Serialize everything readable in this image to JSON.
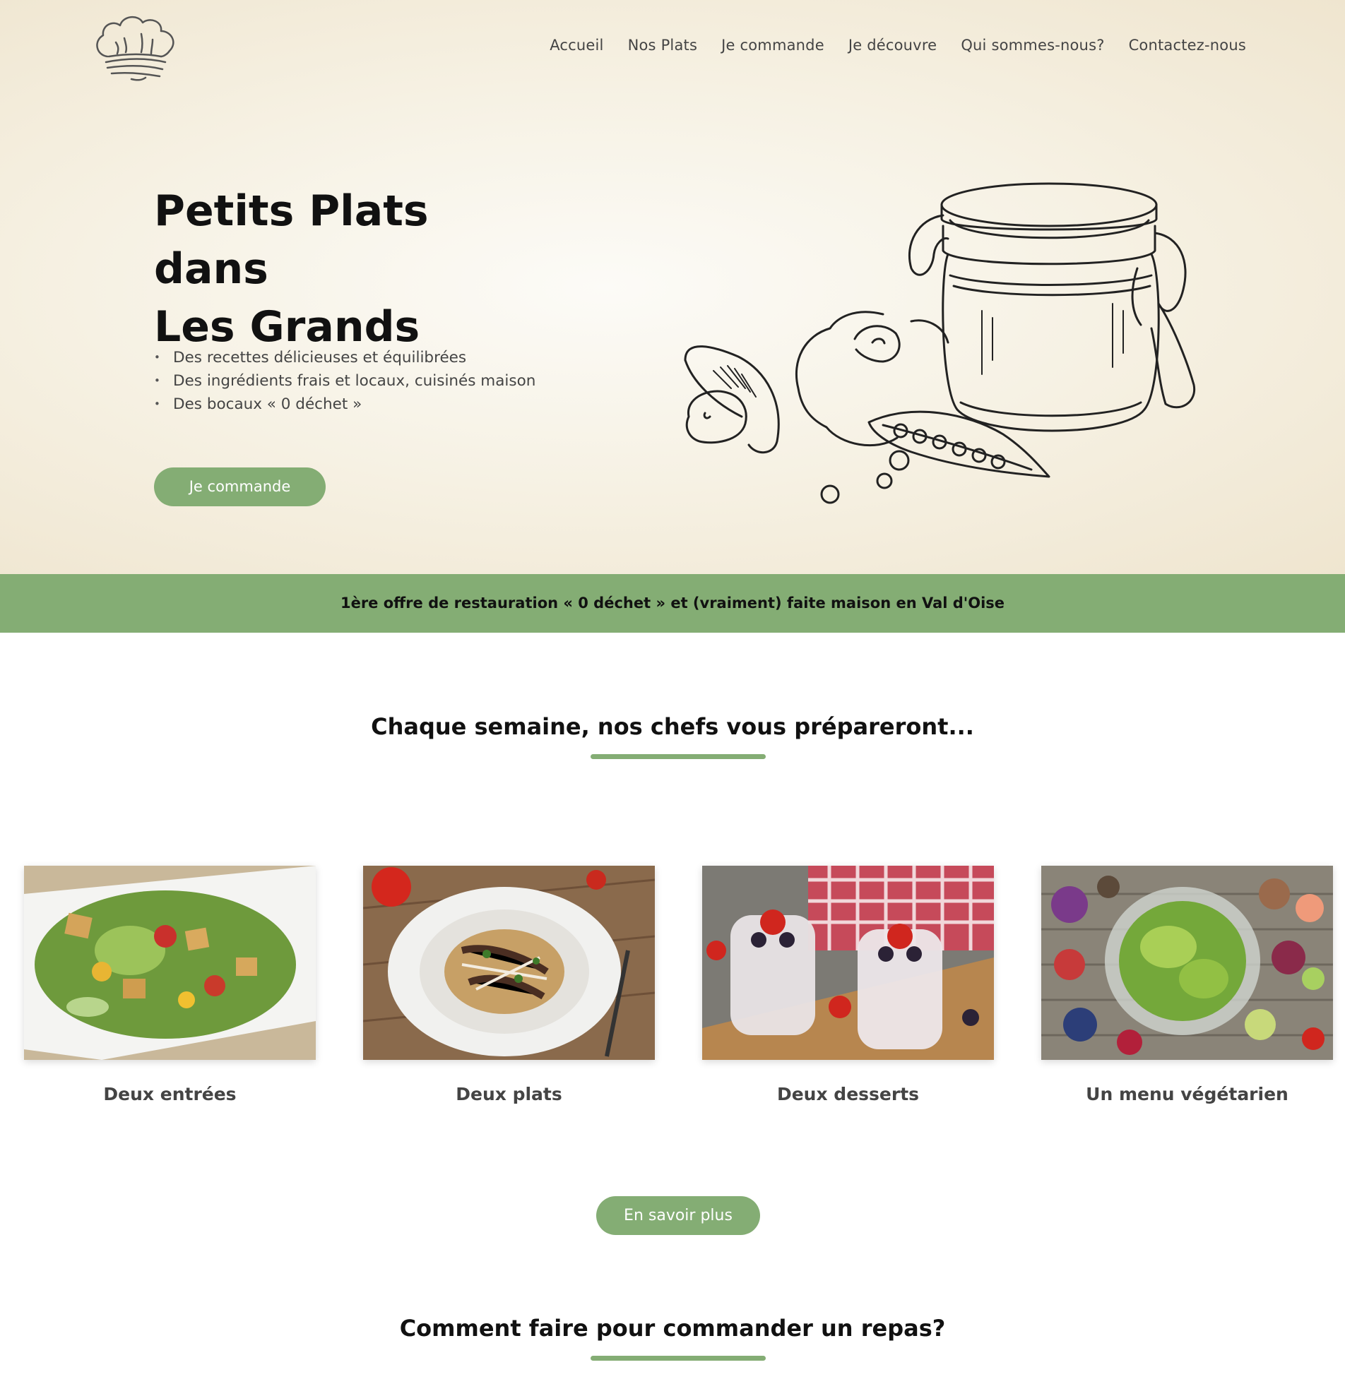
{
  "header": {
    "logo_icon": "chef-hat-icon",
    "nav": [
      "Accueil",
      "Nos Plats",
      "Je commande",
      "Je découvre",
      "Qui sommes-nous?",
      "Contactez-nous"
    ]
  },
  "hero": {
    "title_line1": "Petits Plats dans",
    "title_line2": "Les Grands",
    "bullets": [
      "Des recettes délicieuses et équilibrées",
      "Des ingrédients frais et locaux, cuisinés maison",
      "Des bocaux « 0 déchet »"
    ],
    "cta_label": "Je commande"
  },
  "banner": {
    "text": "1ère offre de restauration « 0 déchet » et (vraiment) faite maison en Val d'Oise"
  },
  "weekly": {
    "title": "Chaque semaine, nos chefs vous prépareront...",
    "cards": [
      {
        "caption": "Deux entrées"
      },
      {
        "caption": "Deux plats"
      },
      {
        "caption": "Deux desserts"
      },
      {
        "caption": "Un menu végétarien"
      }
    ],
    "more_label": "En savoir plus"
  },
  "order": {
    "title": "Comment faire pour commander un repas?"
  },
  "colors": {
    "accent": "#84ad74",
    "hero_bg": "#f6f1e3",
    "text_dark": "#111111"
  }
}
